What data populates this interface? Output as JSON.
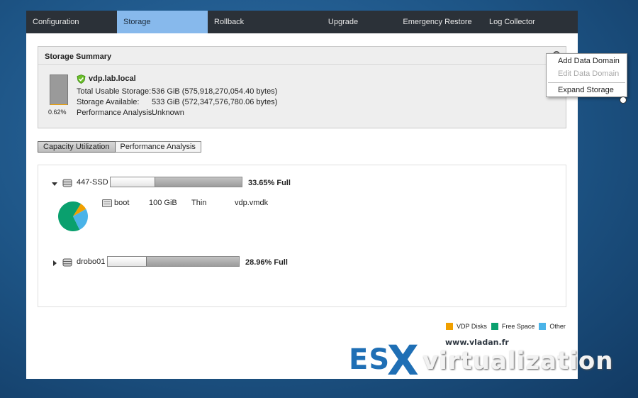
{
  "tabs": [
    {
      "label": "Configuration",
      "active": false
    },
    {
      "label": "Storage",
      "active": true
    },
    {
      "label": "Rollback",
      "active": false
    },
    {
      "label": "Upgrade",
      "active": false
    },
    {
      "label": "Emergency Restore",
      "active": false
    },
    {
      "label": "Log Collector",
      "active": false
    }
  ],
  "summary": {
    "title": "Storage Summary",
    "gauge_percent_label": "0.62%",
    "gauge_fraction": 0.0062,
    "host": "vdp.lab.local",
    "rows": [
      {
        "label": "Total Usable Storage:",
        "value": "536 GiB (575,918,270,054.40 bytes)"
      },
      {
        "label": "Storage Available:",
        "value": "533 GiB (572,347,576,780.06 bytes)"
      },
      {
        "label": "Performance Analysis:",
        "value": "Unknown"
      }
    ]
  },
  "context_menu": {
    "items": [
      {
        "label": "Add Data Domain",
        "enabled": true
      },
      {
        "label": "Edit Data Domain",
        "enabled": false
      },
      {
        "label": "Expand Storage",
        "enabled": true
      }
    ]
  },
  "subtabs": [
    {
      "label": "Capacity Utilization",
      "active": true
    },
    {
      "label": "Performance Analysis",
      "active": false
    }
  ],
  "datastores": [
    {
      "name": "447-SSD",
      "expanded": true,
      "fill_fraction": 0.3365,
      "fill_label": "33.65% Full",
      "disks": [
        {
          "name": "boot",
          "size": "100 GiB",
          "provisioning": "Thin",
          "file": "vdp.vmdk"
        }
      ],
      "pie": {
        "vdp_disks": 0.08,
        "free_space": 0.66,
        "other": 0.26
      }
    },
    {
      "name": "drobo01",
      "expanded": false,
      "fill_fraction": 0.2896,
      "fill_label": "28.96% Full",
      "disks": []
    }
  ],
  "legend": [
    {
      "label": "VDP Disks",
      "color": "#f0a000"
    },
    {
      "label": "Free Space",
      "color": "#0aa06e"
    },
    {
      "label": "Other",
      "color": "#4ab3e8"
    }
  ],
  "watermark": {
    "url": "www.vladan.fr",
    "es": "ES",
    "x": "X",
    "virtualization": "virtualization"
  }
}
